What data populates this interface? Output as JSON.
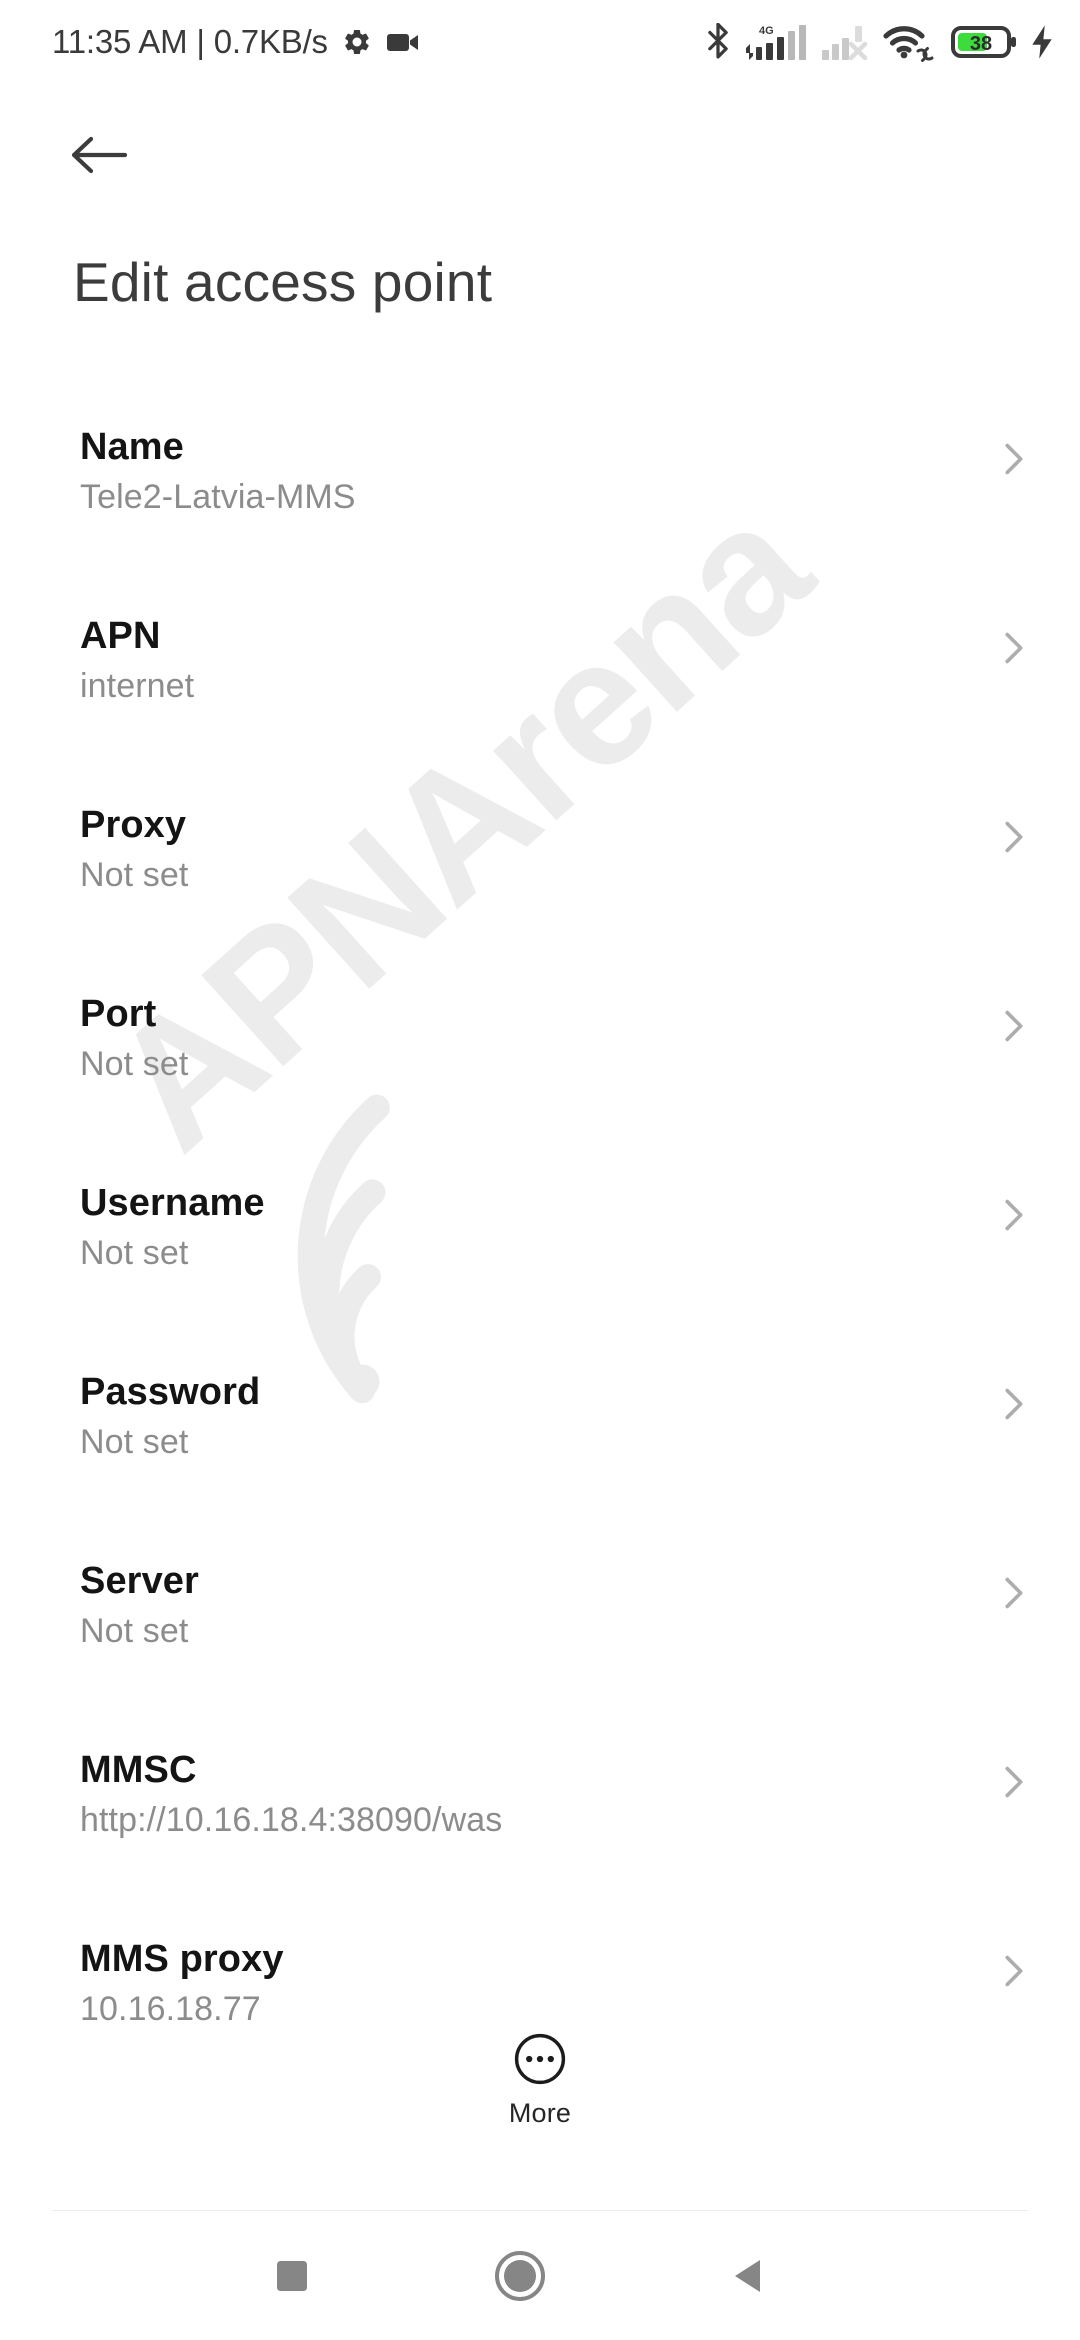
{
  "statusbar": {
    "clock": "11:35 AM | 0.7KB/s",
    "icons_left": [
      "gear-icon",
      "video-camera-icon"
    ],
    "icons_right": [
      "bluetooth-icon",
      "signal-4g-icon",
      "signal-sim2-no-service-icon",
      "wifi-icon",
      "battery-icon",
      "charging-bolt-icon"
    ],
    "network_label": "4G",
    "battery_percent": "38",
    "battery_color": "#3ddc3d"
  },
  "header": {
    "back_label": "Back",
    "title": "Edit access point"
  },
  "watermark": {
    "text": "APNArena",
    "color": "#ececec"
  },
  "rows": [
    {
      "title": "Name",
      "value": "Tele2-Latvia-MMS"
    },
    {
      "title": "APN",
      "value": "internet"
    },
    {
      "title": "Proxy",
      "value": "Not set"
    },
    {
      "title": "Port",
      "value": "Not set"
    },
    {
      "title": "Username",
      "value": "Not set"
    },
    {
      "title": "Password",
      "value": "Not set"
    },
    {
      "title": "Server",
      "value": "Not set"
    },
    {
      "title": "MMSC",
      "value": "http://10.16.18.4:38090/was"
    },
    {
      "title": "MMS proxy",
      "value": "10.16.18.77"
    }
  ],
  "more": {
    "label": "More"
  },
  "navbar": {
    "recents_label": "Recents",
    "home_label": "Home",
    "back_label": "Back"
  }
}
